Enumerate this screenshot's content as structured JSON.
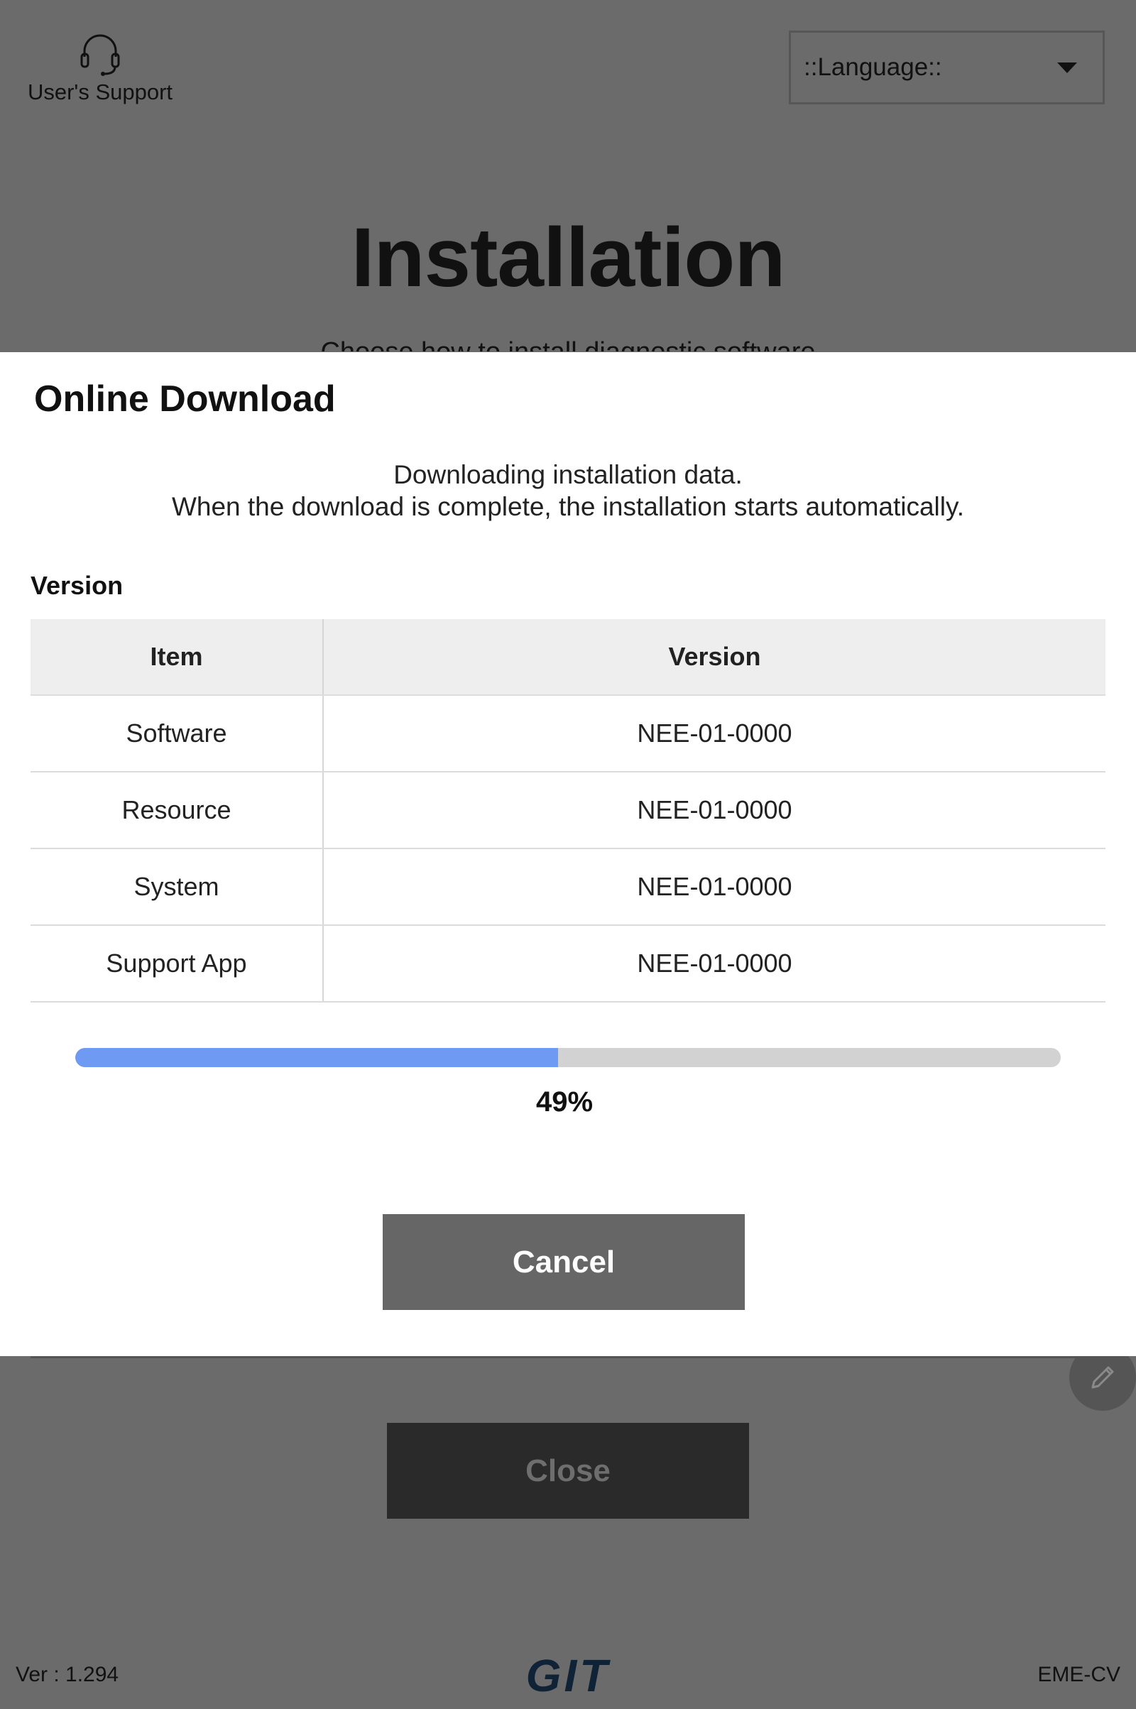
{
  "background": {
    "support_label": "User's Support",
    "language_select": {
      "value": "::Language::"
    },
    "title": "Installation",
    "subtitle": "Choose how to install diagnostic software",
    "close_label": "Close"
  },
  "dialog": {
    "title": "Online Download",
    "message_line1": "Downloading installation data.",
    "message_line2": "When the download is complete, the installation starts automatically.",
    "section_label": "Version",
    "table": {
      "headers": [
        "Item",
        "Version"
      ],
      "rows": [
        {
          "item": "Software",
          "version": "NEE-01-0000"
        },
        {
          "item": "Resource",
          "version": "NEE-01-0000"
        },
        {
          "item": "System",
          "version": "NEE-01-0000"
        },
        {
          "item": "Support App",
          "version": "NEE-01-0000"
        }
      ]
    },
    "progress": {
      "fraction": 0.49,
      "label": "49%"
    },
    "cancel_label": "Cancel"
  },
  "footer": {
    "version": "Ver : 1.294",
    "logo_text": "GIT",
    "code": "EME-CV"
  },
  "colors": {
    "overlay_bg": "#6b6b6b",
    "progress_fill": "#6f9af3",
    "progress_track": "#d2d2d2",
    "cancel_button": "#666666",
    "close_button": "#2a2a2a",
    "logo": "#0f2236"
  },
  "icons": {
    "support": "headset-icon",
    "language_dropdown": "caret-down-icon",
    "edit": "pencil-icon"
  }
}
